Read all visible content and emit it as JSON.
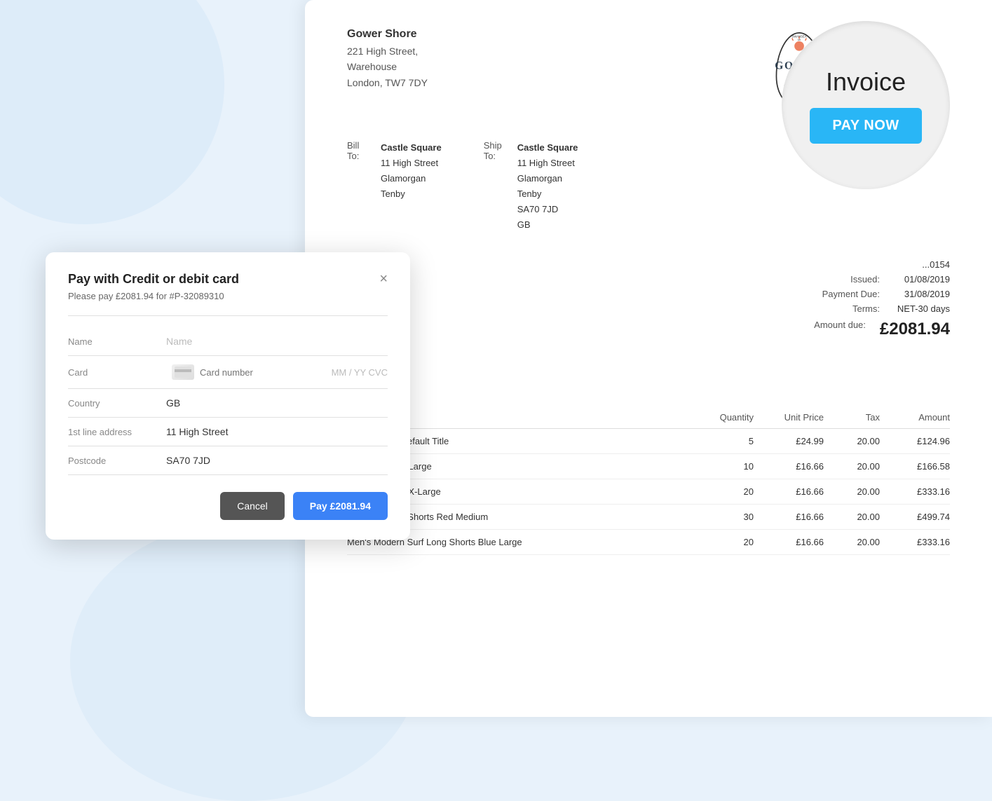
{
  "background": {
    "color": "#e8f2fb"
  },
  "invoice": {
    "company": {
      "name": "Gower Shore",
      "address_line1": "221 High Street,",
      "address_line2": "Warehouse",
      "address_line3": "London, TW7 7DY"
    },
    "bill_to": {
      "label_line1": "Bill",
      "label_line2": "To:",
      "name": "Castle Square",
      "address_line1": "11 High Street",
      "address_line2": "Glamorgan",
      "address_line3": "Tenby"
    },
    "ship_to": {
      "label_line1": "Ship",
      "label_line2": "To:",
      "name": "Castle Square",
      "address_line1": "11 High Street",
      "address_line2": "Glamorgan",
      "address_line3": "Tenby",
      "address_line4": "SA70 7JD",
      "address_line5": "GB"
    },
    "invoice_title": "Invoice",
    "pay_now_label": "PAY NOW",
    "invoice_number": "...0154",
    "issued_label": "Issued:",
    "issued_value": "01/08/2019",
    "payment_due_label": "Payment Due:",
    "payment_due_value": "31/08/2019",
    "terms_label": "Terms:",
    "terms_value": "NET-30 days",
    "amount_due_label": "Amount due:",
    "amount_due_value": "£2081.94",
    "table": {
      "headers": [
        "",
        "Quantity",
        "Unit Price",
        "Tax",
        "Amount"
      ],
      "rows": [
        {
          "description": "ck Backpack Default Title",
          "quantity": "5",
          "unit_price": "£24.99",
          "tax": "20.00",
          "amount": "£124.96"
        },
        {
          "description": "urf Shorts Red Large",
          "quantity": "10",
          "unit_price": "£16.66",
          "tax": "20.00",
          "amount": "£166.58"
        },
        {
          "description": "urf Shorts Red X-Large",
          "quantity": "20",
          "unit_price": "£16.66",
          "tax": "20.00",
          "amount": "£333.16"
        },
        {
          "description": "n's Modern urf Shorts Red Medium",
          "quantity": "30",
          "unit_price": "£16.66",
          "tax": "20.00",
          "amount": "£499.74"
        },
        {
          "description": "Men's Modern Surf Long Shorts Blue Large",
          "quantity": "20",
          "unit_price": "£16.66",
          "tax": "20.00",
          "amount": "£333.16"
        }
      ]
    }
  },
  "modal": {
    "title": "Pay with Credit or debit card",
    "subtitle": "Please pay £2081.94 for #P-32089310",
    "close_label": "×",
    "name_label": "Name",
    "name_placeholder": "Name",
    "card_label": "Card",
    "card_number_placeholder": "Card number",
    "card_expiry_cvc": "MM / YY  CVC",
    "country_label": "Country",
    "country_value": "GB",
    "address_label": "1st line address",
    "address_value": "11 High Street",
    "postcode_label": "Postcode",
    "postcode_value": "SA70 7JD",
    "cancel_label": "Cancel",
    "pay_label": "Pay £2081.94"
  }
}
